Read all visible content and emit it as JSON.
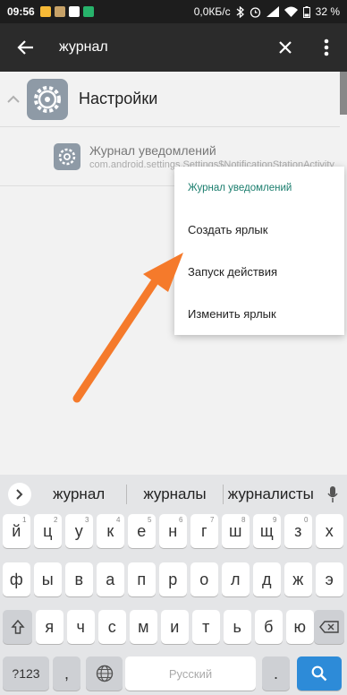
{
  "status_bar": {
    "time": "09:56",
    "network_speed": "0,0КБ/с",
    "battery": "32 %"
  },
  "app_bar": {
    "search_text": "журнал",
    "icons": [
      "back-arrow-icon",
      "close-icon",
      "more-vert-icon"
    ]
  },
  "list": {
    "group_title": "Настройки",
    "child_title": "Журнал уведомлений",
    "child_subtitle": "com.android.settings.Settings$NotificationStationActivity"
  },
  "popup_menu": {
    "title": "Журнал уведомлений",
    "items": [
      "Создать ярлык",
      "Запуск действия",
      "Изменить ярлык"
    ]
  },
  "keyboard": {
    "suggestions": [
      "журнал",
      "журналы",
      "журналисты"
    ],
    "rows": [
      [
        "й",
        "ц",
        "у",
        "к",
        "е",
        "н",
        "г",
        "ш",
        "щ",
        "з",
        "х"
      ],
      [
        "ф",
        "ы",
        "в",
        "а",
        "п",
        "р",
        "о",
        "л",
        "д",
        "ж",
        "э"
      ],
      [
        "я",
        "ч",
        "с",
        "м",
        "и",
        "т",
        "ь",
        "б",
        "ю"
      ]
    ],
    "hints": [
      [
        "1",
        "2",
        "3",
        "4",
        "5",
        "6",
        "7",
        "8",
        "9",
        "0",
        " "
      ]
    ],
    "symbols_key": "?123",
    "comma_key": ",",
    "space_label": "Русский",
    "period_key": "."
  },
  "colors": {
    "app_bar": "#2b2b2b",
    "popup_header": "#1a7d6d",
    "arrow": "#f57a2b",
    "enter_key": "#2d8bd8"
  }
}
